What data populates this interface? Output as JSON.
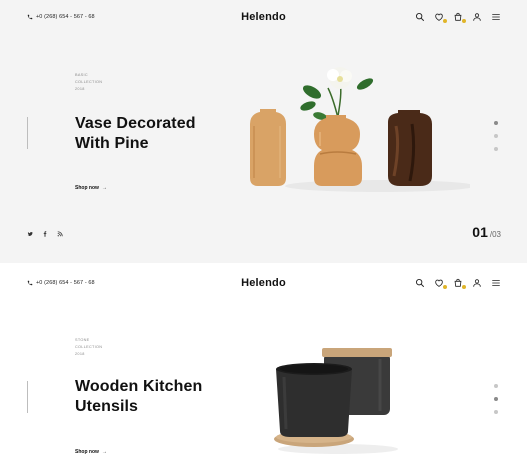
{
  "brand": "Helendo",
  "phone": "+0 (268) 654 - 567 - 68",
  "header_icons": [
    "search-icon",
    "wishlist-icon",
    "cart-icon",
    "user-icon",
    "menu-icon"
  ],
  "accent_color": "#e0b52a",
  "slides": [
    {
      "meta": [
        "Basic",
        "Collection",
        "2018"
      ],
      "title_line1": "Vase Decorated",
      "title_line2": "With Pine",
      "cta": "Shop now",
      "page": "01",
      "total": "/03",
      "social": [
        "twitter-icon",
        "facebook-icon",
        "rss-icon"
      ]
    },
    {
      "meta": [
        "Stone",
        "Collection",
        "2018"
      ],
      "title_line1": "Wooden Kitchen",
      "title_line2": "Utensils",
      "cta": "Shop now"
    }
  ]
}
